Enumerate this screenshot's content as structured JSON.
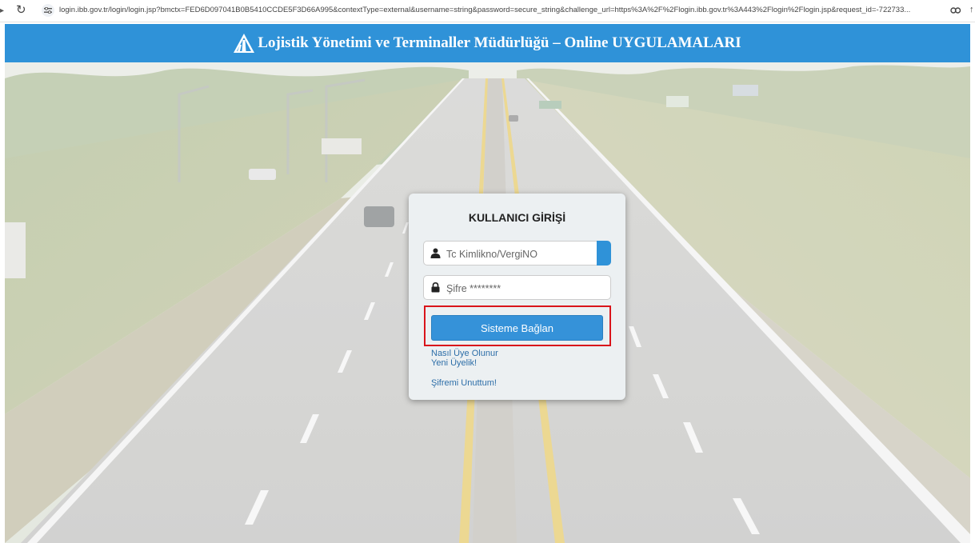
{
  "browser": {
    "url": "login.ibb.gov.tr/login/login.jsp?bmctx=FED6D097041B0B5410CCDE5F3D66A995&contextType=external&username=string&password=secure_string&challenge_url=https%3A%2F%2Flogin.ibb.gov.tr%3A443%2Flogin%2Flogin.jsp&request_id=-722733..."
  },
  "header": {
    "title": "Lojistik Yönetimi ve Terminaller Müdürlüğü – Online UYGULAMALARI",
    "color": "#2f92d8"
  },
  "login": {
    "title": "KULLANICI GİRİŞİ",
    "username_placeholder": "Tc Kimlikno/VergiNO",
    "password_placeholder": "Şifre ********",
    "submit_label": "Sisteme Bağlan",
    "link_how_to_register": "Nasıl Üye Olunur",
    "link_new_member": "Yeni Üyelik!",
    "link_forgot_password": "Şifremi Unuttum!",
    "accent_color": "#3592d9",
    "highlight_color": "#d9141b"
  },
  "icons": {
    "user": "user-icon",
    "lock": "lock-icon",
    "logo": "road-logo-icon",
    "reload": "reload-icon",
    "site_info": "site-info-icon",
    "password_key": "key-icon"
  }
}
